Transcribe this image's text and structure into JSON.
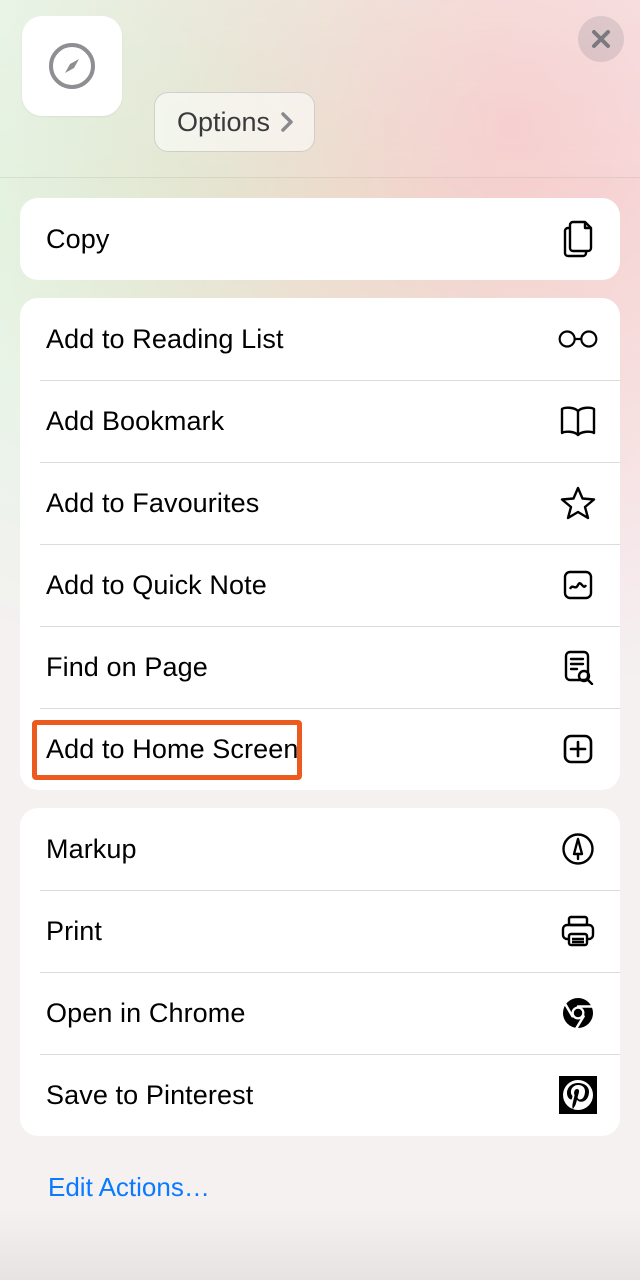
{
  "header": {
    "options_label": "Options"
  },
  "group1": {
    "copy": "Copy"
  },
  "group2": {
    "reading_list": "Add to Reading List",
    "bookmark": "Add Bookmark",
    "favourites": "Add to Favourites",
    "quick_note": "Add to Quick Note",
    "find_on_page": "Find on Page",
    "home_screen": "Add to Home Screen"
  },
  "group3": {
    "markup": "Markup",
    "print": "Print",
    "open_chrome": "Open in Chrome",
    "save_pinterest": "Save to Pinterest"
  },
  "footer": {
    "edit_actions": "Edit Actions…"
  },
  "highlight": {
    "target": "home_screen"
  },
  "colors": {
    "accent": "#0a7aff",
    "highlight": "#ec5a1f"
  }
}
